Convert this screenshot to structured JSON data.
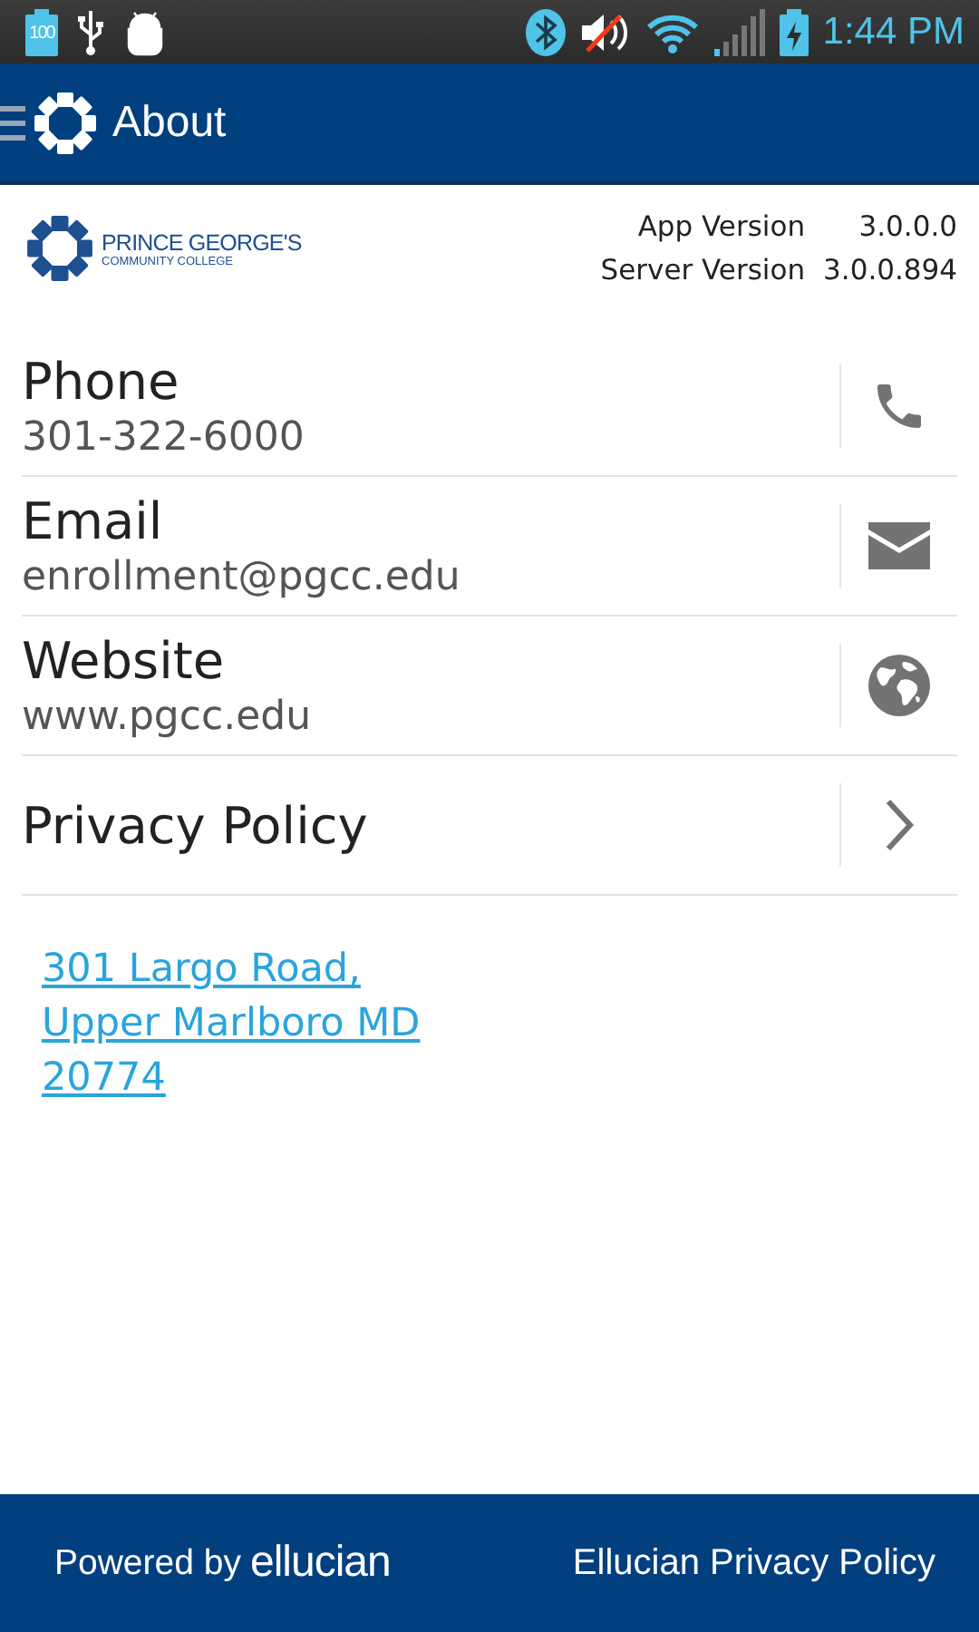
{
  "status_bar": {
    "battery_level_text": "100",
    "time": "1:44 PM"
  },
  "app_bar": {
    "title": "About"
  },
  "header": {
    "logo_name": "PRINCE GEORGE'S",
    "logo_subname": "COMMUNITY COLLEGE",
    "versions": [
      {
        "label": "App Version",
        "value": "3.0.0.0"
      },
      {
        "label": "Server Version",
        "value": "3.0.0.894"
      }
    ]
  },
  "rows": [
    {
      "label": "Phone",
      "value": "301-322-6000",
      "kind": "phone"
    },
    {
      "label": "Email",
      "value": "enrollment@pgcc.edu",
      "kind": "email"
    },
    {
      "label": "Website",
      "value": "www.pgcc.edu",
      "kind": "website"
    },
    {
      "label": "Privacy Policy",
      "kind": "link"
    }
  ],
  "address": {
    "lines": [
      "301 Largo Road,",
      "Upper Marlboro MD",
      "20774"
    ]
  },
  "footer": {
    "powered_by": "Powered by",
    "brand": "ellucian",
    "privacy_link": "Ellucian Privacy Policy"
  }
}
